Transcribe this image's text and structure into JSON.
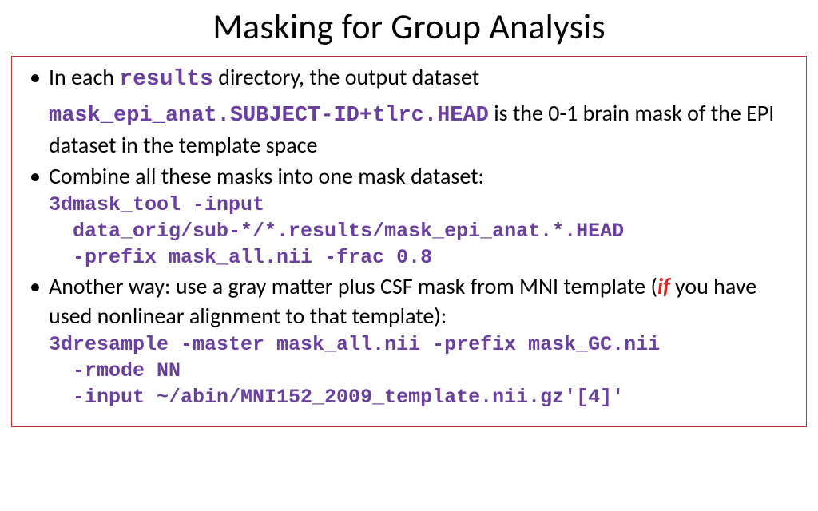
{
  "title": "Masking for Group Analysis",
  "bullets": [
    {
      "parts": {
        "t1": "In each ",
        "code1": "results",
        "t2": " directory, the output dataset",
        "filename": "mask_epi_anat.SUBJECT-ID+tlrc.HEAD",
        "t3": " is the 0-1 brain mask of the EPI dataset in the template space"
      }
    },
    {
      "parts": {
        "t1": "Combine all these masks into one mask dataset:",
        "cmd": "3dmask_tool -input\n  data_orig/sub-*/*.results/mask_epi_anat.*.HEAD\n  -prefix mask_all.nii -frac 0.8"
      }
    },
    {
      "parts": {
        "t1": "Another way: use a gray matter plus CSF mask from MNI template (",
        "ifword": "if",
        "t2": " you have used nonlinear alignment to that template):",
        "cmd": "3dresample -master mask_all.nii -prefix mask_GC.nii\n  -rmode NN\n  -input ~/abin/MNI152_2009_template.nii.gz'[4]'"
      }
    }
  ]
}
